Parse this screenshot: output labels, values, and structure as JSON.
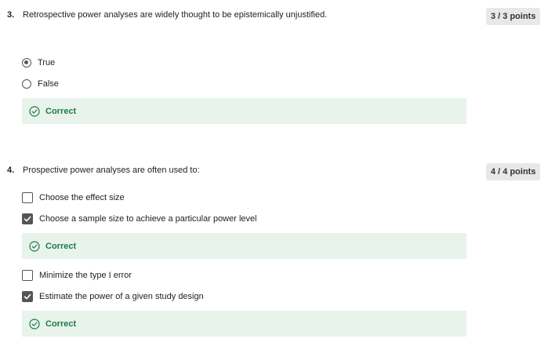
{
  "questions": [
    {
      "number": "3.",
      "text": "Retrospective power analyses are widely thought to be epistemically unjustified.",
      "points": "3 / 3 points",
      "options": [
        {
          "label": "True",
          "checked": true
        },
        {
          "label": "False",
          "checked": false
        }
      ],
      "feedback": "Correct"
    },
    {
      "number": "4.",
      "text": "Prospective power analyses are often used to:",
      "points": "4 / 4 points",
      "options": [
        {
          "label": "Choose the effect size",
          "checked": false
        },
        {
          "label": "Choose a sample size to achieve a particular power level",
          "checked": true,
          "feedback": "Correct"
        },
        {
          "label": "Minimize the type I error",
          "checked": false
        },
        {
          "label": "Estimate the power of a given study design",
          "checked": true,
          "feedback": "Correct"
        }
      ]
    }
  ],
  "colors": {
    "correct_bg": "#e8f3ec",
    "correct_text": "#1d7a46",
    "badge_bg": "#e8e8e8",
    "control": "#555555"
  },
  "icons": {
    "radio": "radio-icon",
    "checkbox": "checkbox-icon",
    "correct": "check-circle-icon"
  }
}
